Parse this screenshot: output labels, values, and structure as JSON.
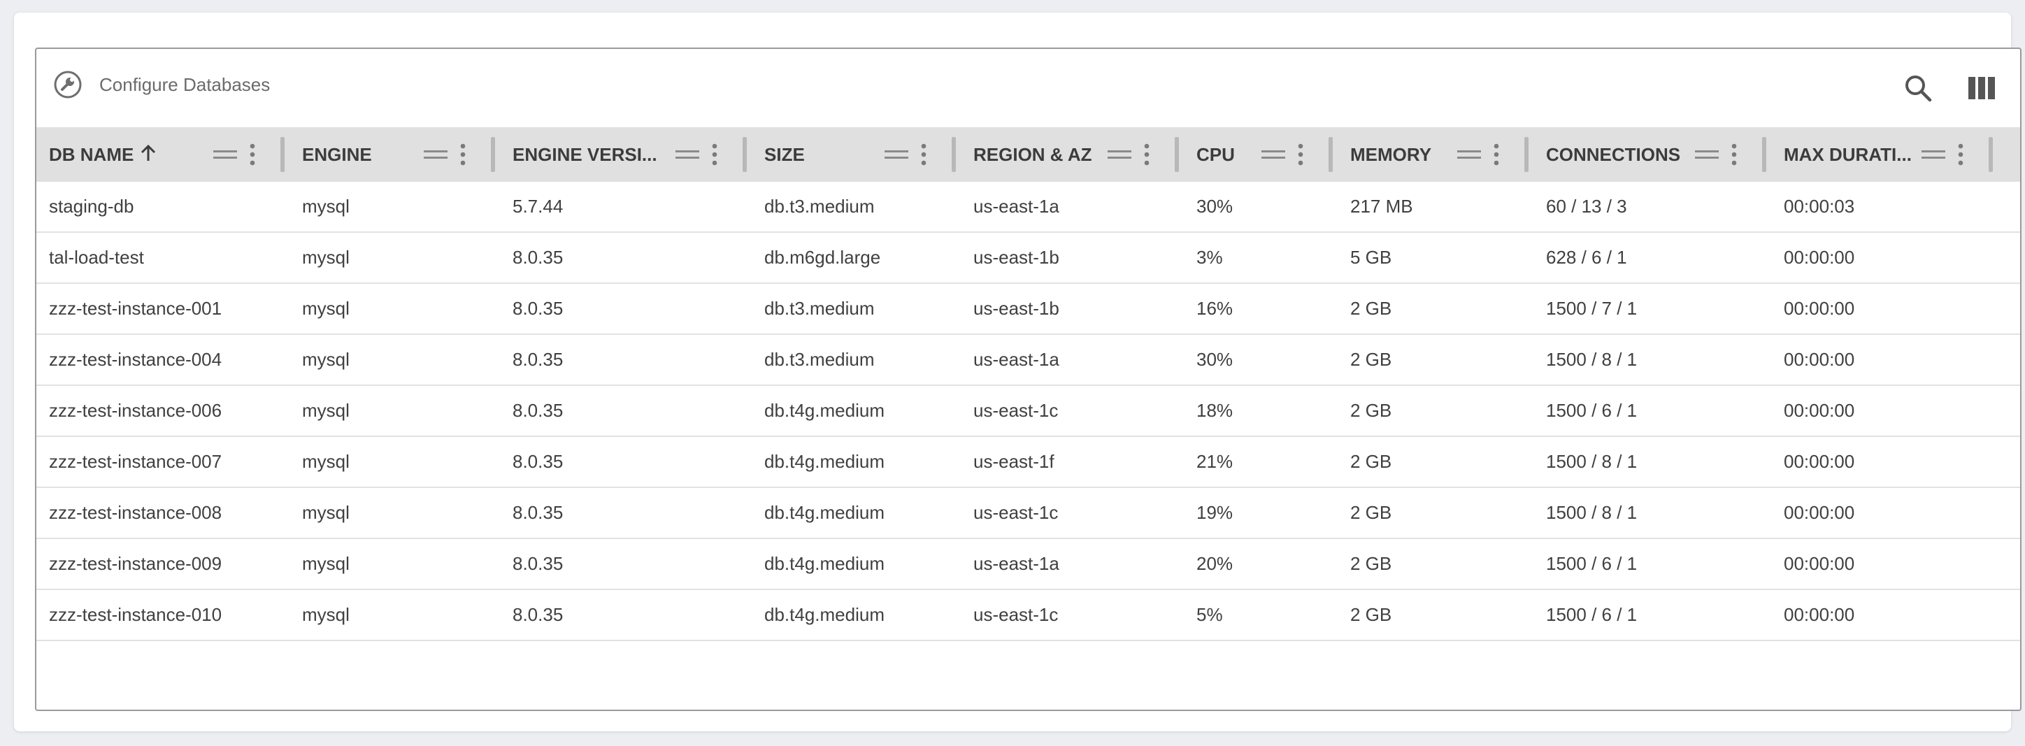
{
  "toolbar": {
    "title": "Configure Databases",
    "title_icon": "wrench-icon",
    "search_icon": "search-icon",
    "columns_icon": "view-columns-icon"
  },
  "table": {
    "sorted_column": "DB NAME",
    "sort_direction": "ascending",
    "columns": [
      {
        "key": "name",
        "label": "DB NAME"
      },
      {
        "key": "engine",
        "label": "ENGINE"
      },
      {
        "key": "version",
        "label": "ENGINE VERSI..."
      },
      {
        "key": "size",
        "label": "SIZE"
      },
      {
        "key": "region",
        "label": "REGION & AZ"
      },
      {
        "key": "cpu",
        "label": "CPU"
      },
      {
        "key": "memory",
        "label": "MEMORY"
      },
      {
        "key": "connections",
        "label": "CONNECTIONS"
      },
      {
        "key": "duration",
        "label": "MAX DURATI..."
      }
    ],
    "rows": [
      {
        "name": "staging-db",
        "engine": "mysql",
        "version": "5.7.44",
        "size": "db.t3.medium",
        "region": "us-east-1a",
        "cpu": "30%",
        "memory": "217 MB",
        "connections": "60 / 13 / 3",
        "duration": "00:00:03"
      },
      {
        "name": "tal-load-test",
        "engine": "mysql",
        "version": "8.0.35",
        "size": "db.m6gd.large",
        "region": "us-east-1b",
        "cpu": "3%",
        "memory": "5 GB",
        "connections": "628 / 6 / 1",
        "duration": "00:00:00"
      },
      {
        "name": "zzz-test-instance-001",
        "engine": "mysql",
        "version": "8.0.35",
        "size": "db.t3.medium",
        "region": "us-east-1b",
        "cpu": "16%",
        "memory": "2 GB",
        "connections": "1500 / 7 / 1",
        "duration": "00:00:00"
      },
      {
        "name": "zzz-test-instance-004",
        "engine": "mysql",
        "version": "8.0.35",
        "size": "db.t3.medium",
        "region": "us-east-1a",
        "cpu": "30%",
        "memory": "2 GB",
        "connections": "1500 / 8 / 1",
        "duration": "00:00:00"
      },
      {
        "name": "zzz-test-instance-006",
        "engine": "mysql",
        "version": "8.0.35",
        "size": "db.t4g.medium",
        "region": "us-east-1c",
        "cpu": "18%",
        "memory": "2 GB",
        "connections": "1500 / 6 / 1",
        "duration": "00:00:00"
      },
      {
        "name": "zzz-test-instance-007",
        "engine": "mysql",
        "version": "8.0.35",
        "size": "db.t4g.medium",
        "region": "us-east-1f",
        "cpu": "21%",
        "memory": "2 GB",
        "connections": "1500 / 8 / 1",
        "duration": "00:00:00"
      },
      {
        "name": "zzz-test-instance-008",
        "engine": "mysql",
        "version": "8.0.35",
        "size": "db.t4g.medium",
        "region": "us-east-1c",
        "cpu": "19%",
        "memory": "2 GB",
        "connections": "1500 / 8 / 1",
        "duration": "00:00:00"
      },
      {
        "name": "zzz-test-instance-009",
        "engine": "mysql",
        "version": "8.0.35",
        "size": "db.t4g.medium",
        "region": "us-east-1a",
        "cpu": "20%",
        "memory": "2 GB",
        "connections": "1500 / 6 / 1",
        "duration": "00:00:00"
      },
      {
        "name": "zzz-test-instance-010",
        "engine": "mysql",
        "version": "8.0.35",
        "size": "db.t4g.medium",
        "region": "us-east-1c",
        "cpu": "5%",
        "memory": "2 GB",
        "connections": "1500 / 6 / 1",
        "duration": "00:00:00"
      }
    ]
  }
}
